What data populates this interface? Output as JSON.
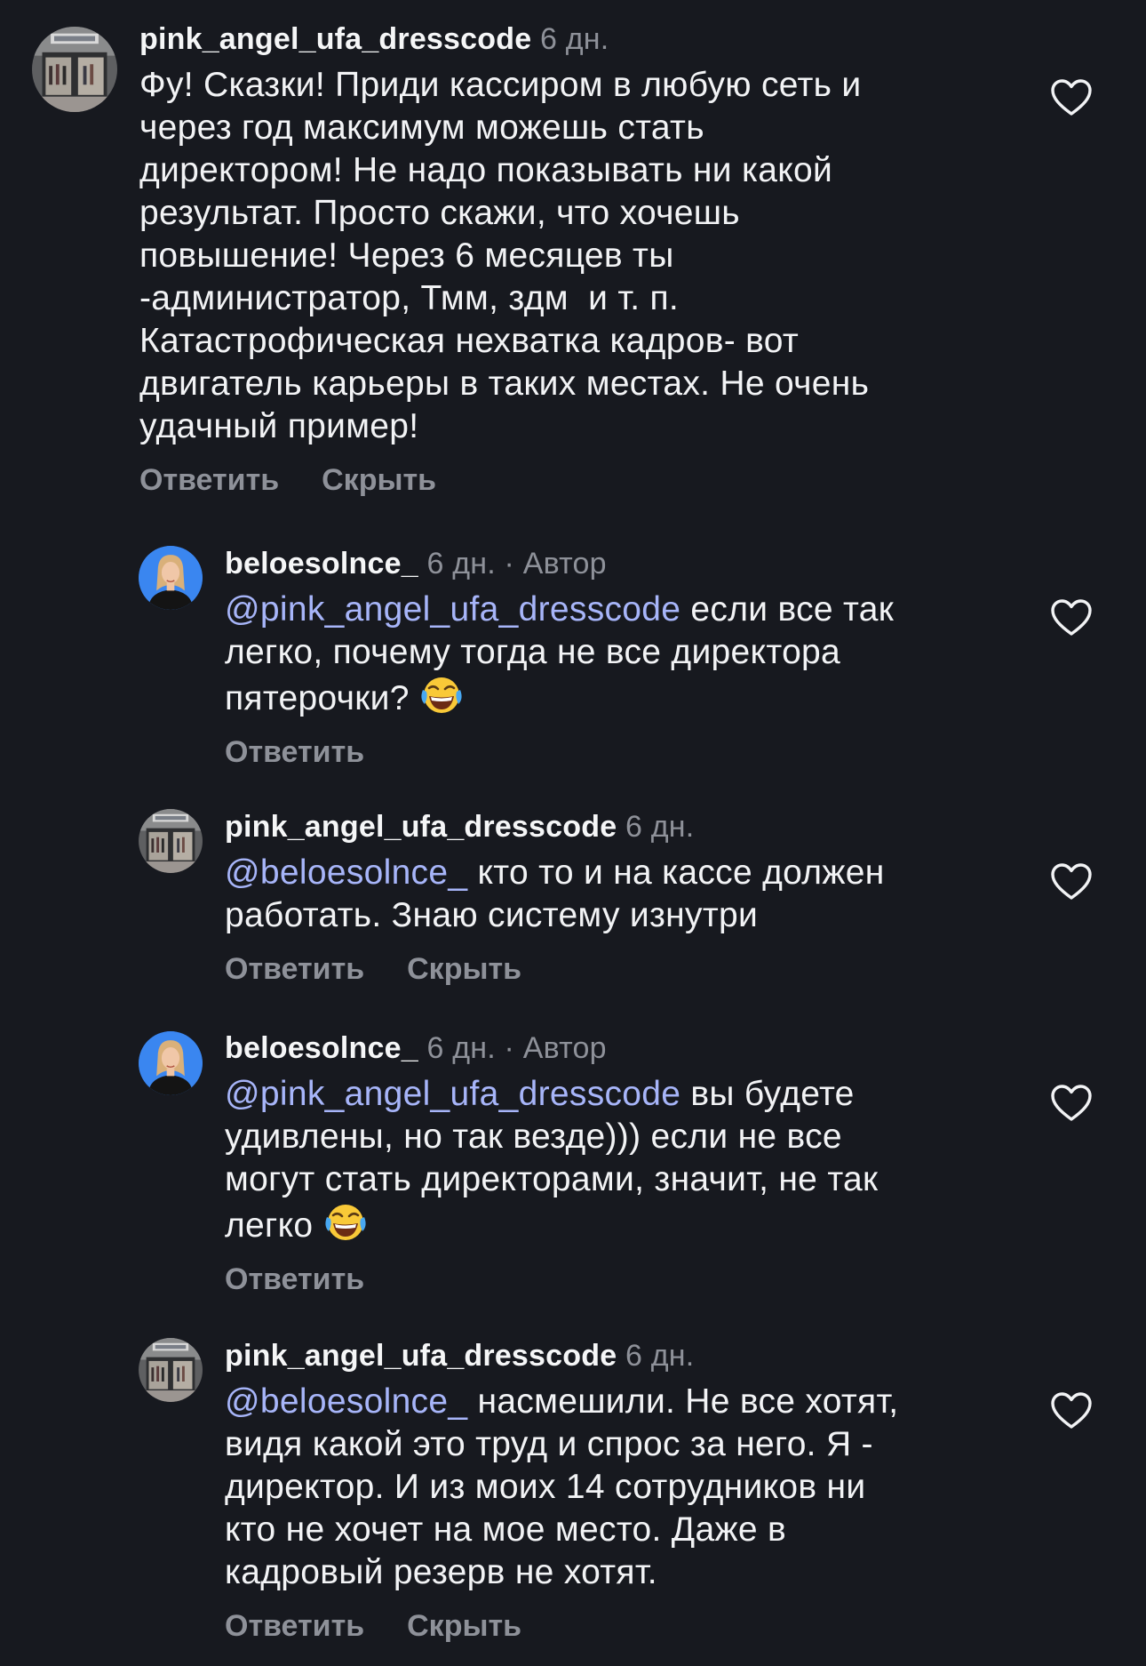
{
  "comments": [
    {
      "username": "pink_angel_ufa_dresscode",
      "time": "6 дн.",
      "author_tag": "",
      "mention": "",
      "text": "Фу! Сказки! Приди кассиром в любую сеть и\nчерез год максимум можешь стать\nдиректором! Не надо показывать ни какой\nрезультат. Просто скажи, что хочешь\nповышение! Через 6 месяцев ты\n-администратор, Тмм, здм  и т. п.\nКатастрофическая нехватка кадров- вот\nдвигатель карьеры в таких местах. Не очень\nудачный пример!",
      "reply_label": "Ответить",
      "hide_label": "Скрыть",
      "avatar_icon": "dresscode-store-avatar",
      "like_icon": "heart-outline-icon"
    },
    {
      "username": "beloesolnce_",
      "time": "6 дн.",
      "author_tag": " · Автор",
      "mention": "@pink_angel_ufa_dresscode",
      "text": " если все так\nлегко, почему тогда не все директора\nпятерочки?",
      "emoji": "face-with-tears-of-joy-emoji",
      "reply_label": "Ответить",
      "hide_label": "",
      "avatar_icon": "woman-portrait-avatar",
      "like_icon": "heart-outline-icon"
    },
    {
      "username": "pink_angel_ufa_dresscode",
      "time": "6 дн.",
      "author_tag": "",
      "mention": "@beloesolnce_",
      "text": " кто то и на кассе должен\nработать. Знаю систему изнутри",
      "reply_label": "Ответить",
      "hide_label": "Скрыть",
      "avatar_icon": "dresscode-store-avatar",
      "like_icon": "heart-outline-icon"
    },
    {
      "username": "beloesolnce_",
      "time": "6 дн.",
      "author_tag": " · Автор",
      "mention": "@pink_angel_ufa_dresscode",
      "text": " вы будете\nудивлены, но так везде))) если не все\nмогут стать директорами, значит, не так\nлегко",
      "emoji": "face-with-tears-of-joy-emoji",
      "reply_label": "Ответить",
      "hide_label": "",
      "avatar_icon": "woman-portrait-avatar",
      "like_icon": "heart-outline-icon"
    },
    {
      "username": "pink_angel_ufa_dresscode",
      "time": "6 дн.",
      "author_tag": "",
      "mention": "@beloesolnce_",
      "text": " насмешили. Не все хотят,\nвидя какой это труд и спрос за него. Я -\nдиректор. И из моих 14 сотрудников ни\nкто не хочет на мое место. Даже в\nкадровый резерв не хотят.",
      "reply_label": "Ответить",
      "hide_label": "Скрыть",
      "avatar_icon": "dresscode-store-avatar",
      "like_icon": "heart-outline-icon"
    }
  ],
  "colors": {
    "background": "#17191f",
    "text": "#f2f3f5",
    "muted": "#8e9199",
    "mention": "#a7b5f9"
  }
}
